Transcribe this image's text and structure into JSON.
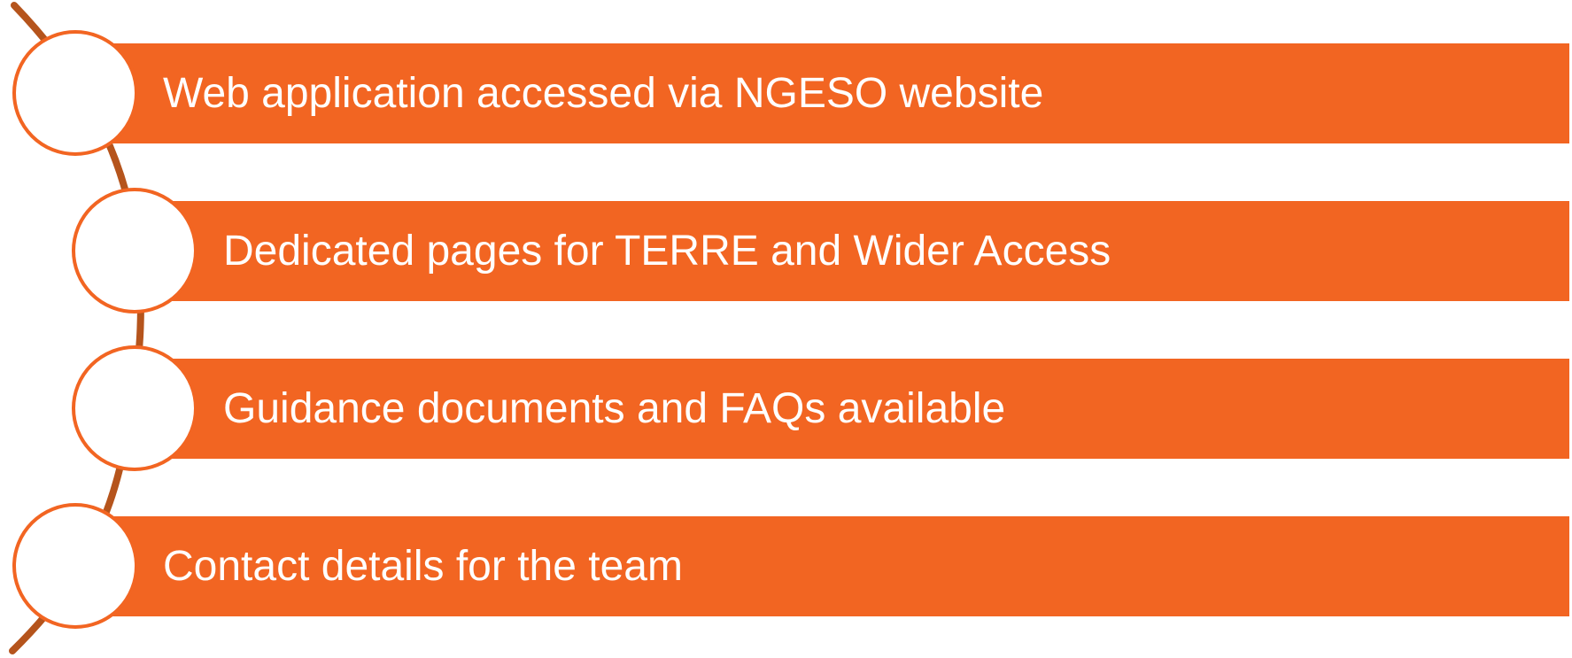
{
  "colors": {
    "bar_fill": "#F26522",
    "circle_border": "#F26522",
    "arc": "#B5541C",
    "text": "#FFFFFF"
  },
  "items": [
    {
      "label": "Web application accessed via NGESO website"
    },
    {
      "label": "Dedicated pages for TERRE and Wider Access"
    },
    {
      "label": "Guidance documents and FAQs available"
    },
    {
      "label": "Contact details for the team"
    }
  ]
}
